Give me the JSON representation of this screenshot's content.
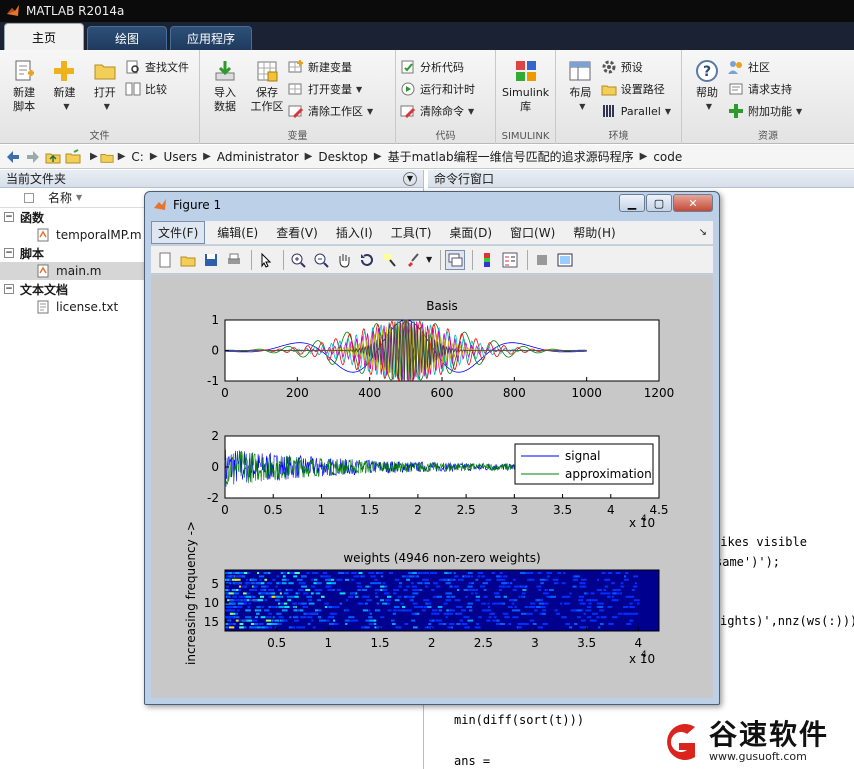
{
  "window": {
    "title": "MATLAB R2014a"
  },
  "ribbon": {
    "tabs": [
      "主页",
      "绘图",
      "应用程序"
    ],
    "groups": {
      "file": {
        "label": "文件",
        "new_script": "新建\n脚本",
        "new": "新建",
        "open": "打开",
        "find_files": "查找文件",
        "compare": "比较"
      },
      "variable": {
        "label": "变量",
        "import_data": "导入\n数据",
        "save_workspace": "保存\n工作区",
        "new_variable": "新建变量",
        "open_variable": "打开变量",
        "clear_workspace": "清除工作区"
      },
      "code": {
        "label": "代码",
        "analyze_code": "分析代码",
        "run_and_time": "运行和计时",
        "clear_commands": "清除命令"
      },
      "simulink": {
        "label": "SIMULINK",
        "simulink_lib": "Simulink\n库"
      },
      "environment": {
        "label": "环境",
        "layout": "布局",
        "preferences": "预设",
        "set_path": "设置路径",
        "parallel": "Parallel"
      },
      "resources": {
        "label": "资源",
        "help": "帮助",
        "community": "社区",
        "request_support": "请求支持",
        "add_ons": "附加功能"
      }
    }
  },
  "address": {
    "crumbs": [
      "C:",
      "Users",
      "Administrator",
      "Desktop",
      "基于matlab编程一维信号匹配的追求源码程序",
      "code"
    ]
  },
  "current_folder": {
    "title": "当前文件夹",
    "column_name": "名称",
    "groups": [
      {
        "label": "函数",
        "items": [
          "temporalMP.m"
        ]
      },
      {
        "label": "脚本",
        "items": [
          "main.m"
        ]
      },
      {
        "label": "文本文档",
        "items": [
          "license.txt"
        ]
      }
    ]
  },
  "command_window": {
    "title": "命令行窗口",
    "lines": [
      "pikes visible",
      "same')');",
      "ights)',nnz(ws(:)))",
      "min(diff(sort(t)))",
      "ans ="
    ]
  },
  "figure": {
    "title": "Figure 1",
    "menus": [
      "文件(F)",
      "编辑(E)",
      "查看(V)",
      "插入(I)",
      "工具(T)",
      "桌面(D)",
      "窗口(W)",
      "帮助(H)"
    ]
  },
  "chart_data": [
    {
      "type": "line",
      "title": "Basis",
      "xlabel": "",
      "ylabel": "",
      "xlim": [
        0,
        1200
      ],
      "ylim": [
        -1,
        1
      ],
      "xticks": [
        0,
        200,
        400,
        600,
        800,
        1000,
        1200
      ],
      "yticks": [
        -1,
        0,
        1
      ],
      "series_colors": [
        "#0000ff",
        "#008000",
        "#ff0000",
        "#00bfbf",
        "#bf00bf",
        "#bfbf00",
        "#404040"
      ],
      "data_extent": [
        0,
        1000
      ]
    },
    {
      "type": "line",
      "title": "",
      "xlabel": "",
      "ylabel": "",
      "xlim": [
        0,
        4.5
      ],
      "ylim": [
        -2,
        2
      ],
      "xticks": [
        "0",
        "0.5",
        "1",
        "1.5",
        "2",
        "2.5",
        "3",
        "3.5",
        "4",
        "4.5"
      ],
      "yticks": [
        -2,
        0,
        2
      ],
      "x_multiplier": "x 10",
      "x_exponent": "4",
      "series": [
        {
          "name": "signal",
          "color": "#0000ff"
        },
        {
          "name": "approximation",
          "color": "#008000"
        }
      ],
      "legend": "top-right",
      "data_extent": [
        0,
        3.75
      ]
    },
    {
      "type": "heatmap",
      "title": "weights (4946 non-zero weights)",
      "xlabel": "",
      "ylabel": "increasing frequency ->",
      "xticks": [
        "0.5",
        "1",
        "1.5",
        "2",
        "2.5",
        "3",
        "3.5",
        "4"
      ],
      "yticks": [
        "5",
        "10",
        "15"
      ],
      "x_multiplier": "x 10",
      "x_exponent": "4",
      "background_color": "#00008f"
    }
  ],
  "watermark": {
    "name": "谷速软件",
    "url": "www.gusuoft.com"
  }
}
